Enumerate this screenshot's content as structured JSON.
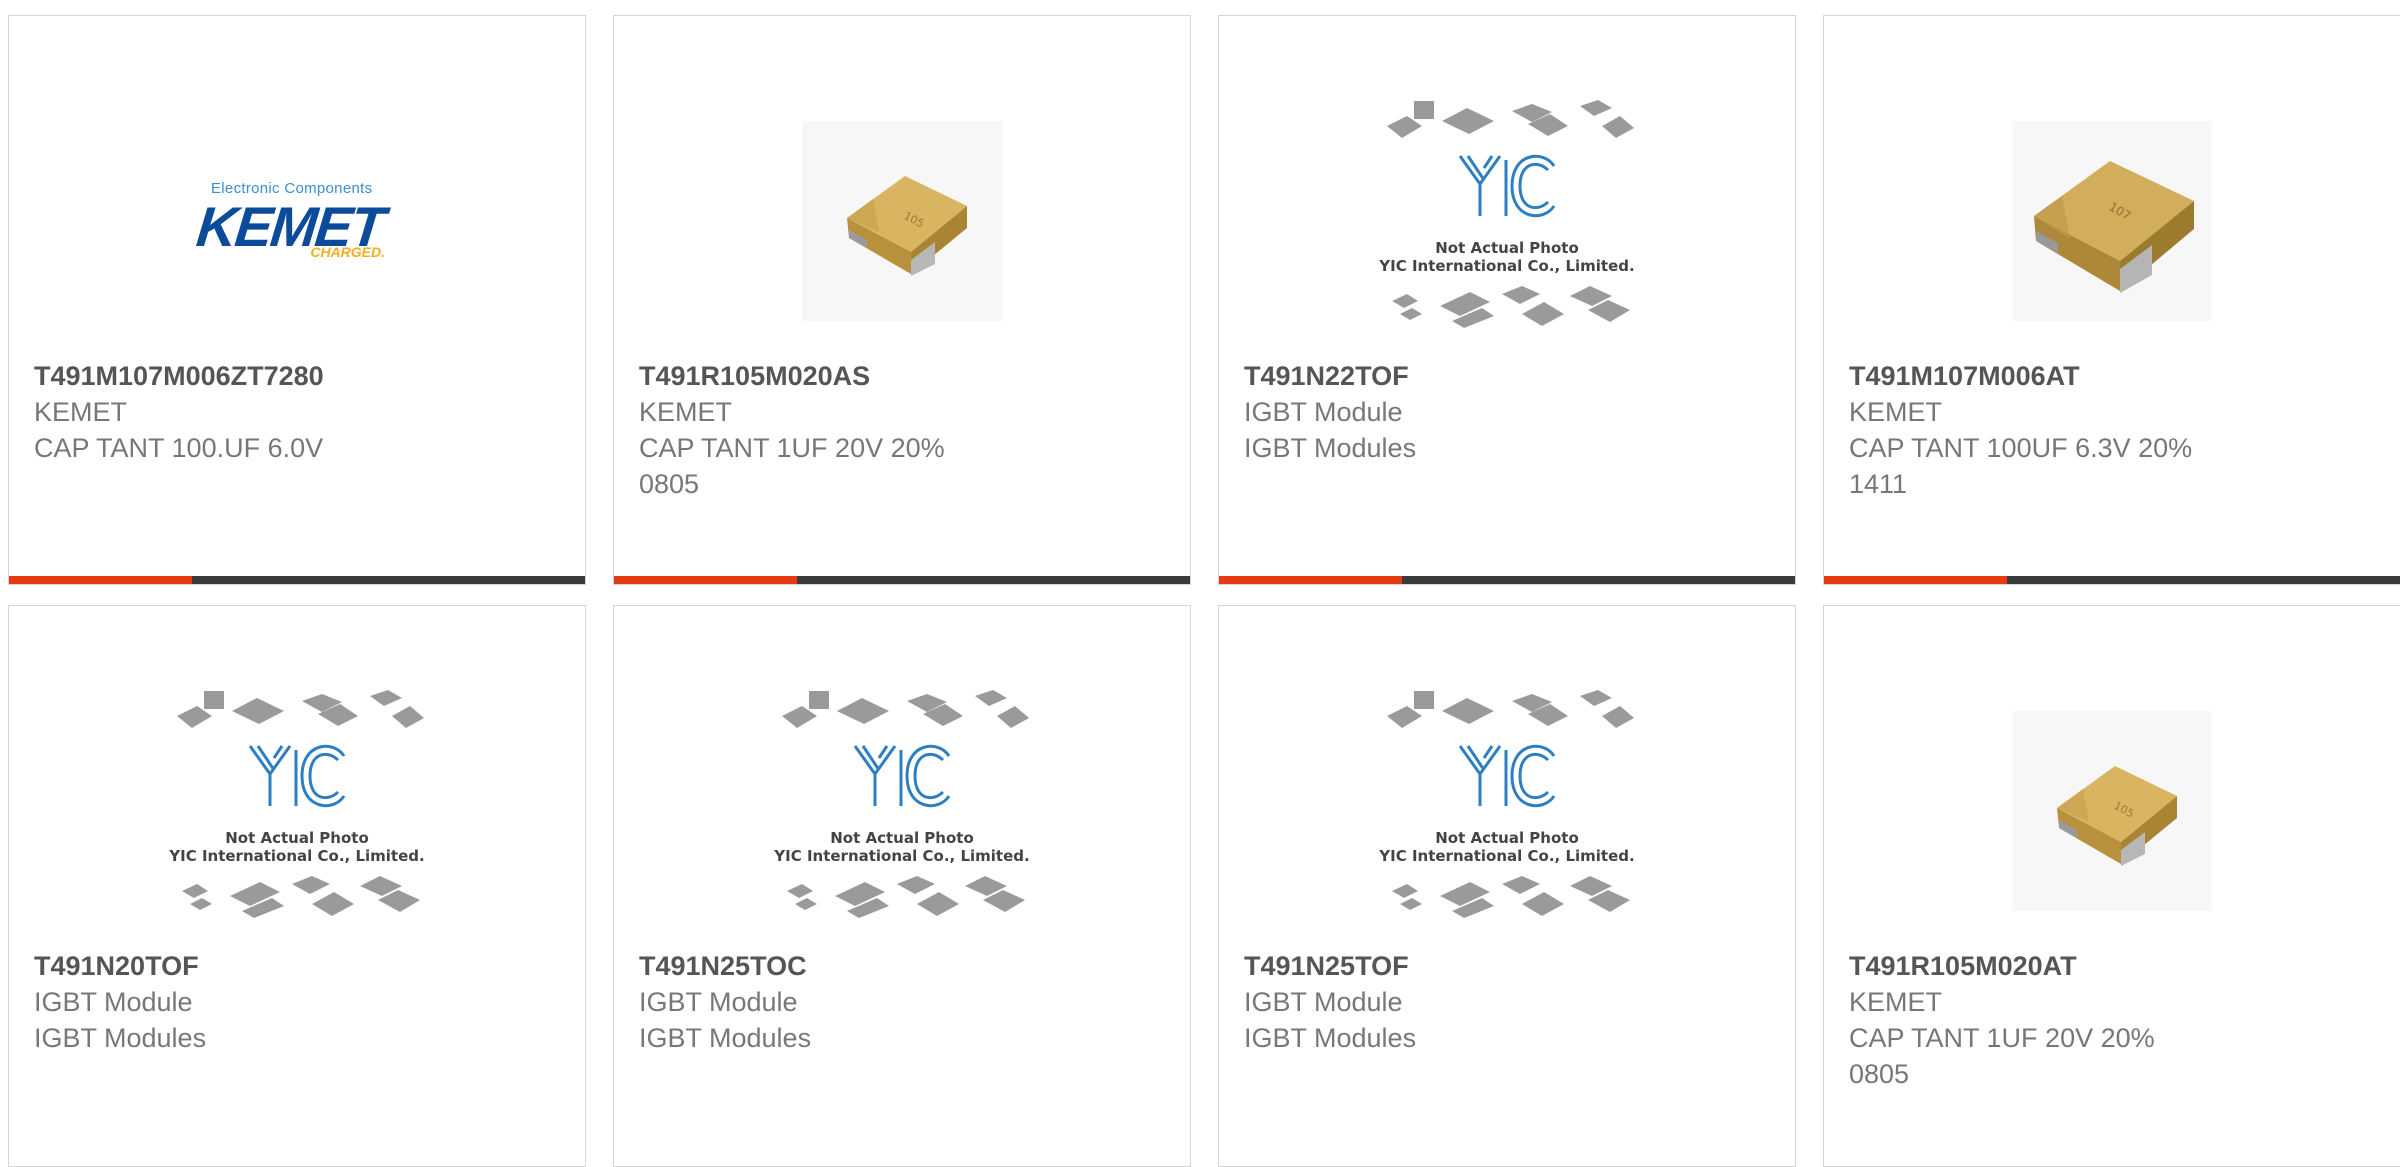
{
  "placeholder": {
    "line1": "Not Actual Photo",
    "line2": "YIC International Co., Limited."
  },
  "kemet_logo": {
    "top": "Electronic Components",
    "mid": "KEMET",
    "bot": "CHARGED."
  },
  "products": [
    {
      "part_number": "T491M107M006ZT7280",
      "manufacturer": "KEMET",
      "description": "CAP TANT 100.UF 6.0V",
      "image": "kemet-logo"
    },
    {
      "part_number": "T491R105M020AS",
      "manufacturer": "KEMET",
      "description": "CAP TANT 1UF 20V 20% 0805",
      "image": "tantalum-chip"
    },
    {
      "part_number": "T491N22TOF",
      "manufacturer": "IGBT Module",
      "description": "IGBT Modules",
      "image": "yic-placeholder"
    },
    {
      "part_number": "T491M107M006AT",
      "manufacturer": "KEMET",
      "description": "CAP TANT 100UF 6.3V 20% 1411",
      "image": "tantalum-chip"
    },
    {
      "part_number": "T491N20TOF",
      "manufacturer": "IGBT Module",
      "description": "IGBT Modules",
      "image": "yic-placeholder"
    },
    {
      "part_number": "T491N25TOC",
      "manufacturer": "IGBT Module",
      "description": "IGBT Modules",
      "image": "yic-placeholder"
    },
    {
      "part_number": "T491N25TOF",
      "manufacturer": "IGBT Module",
      "description": "IGBT Modules",
      "image": "yic-placeholder"
    },
    {
      "part_number": "T491R105M020AT",
      "manufacturer": "KEMET",
      "description": "CAP TANT 1UF 20V 20% 0805",
      "image": "tantalum-chip"
    }
  ],
  "colors": {
    "accent": "#e63a12",
    "bar": "#3b3b3b",
    "chip_body": "#c9a24a",
    "yic_blue": "#2d7fc1"
  }
}
